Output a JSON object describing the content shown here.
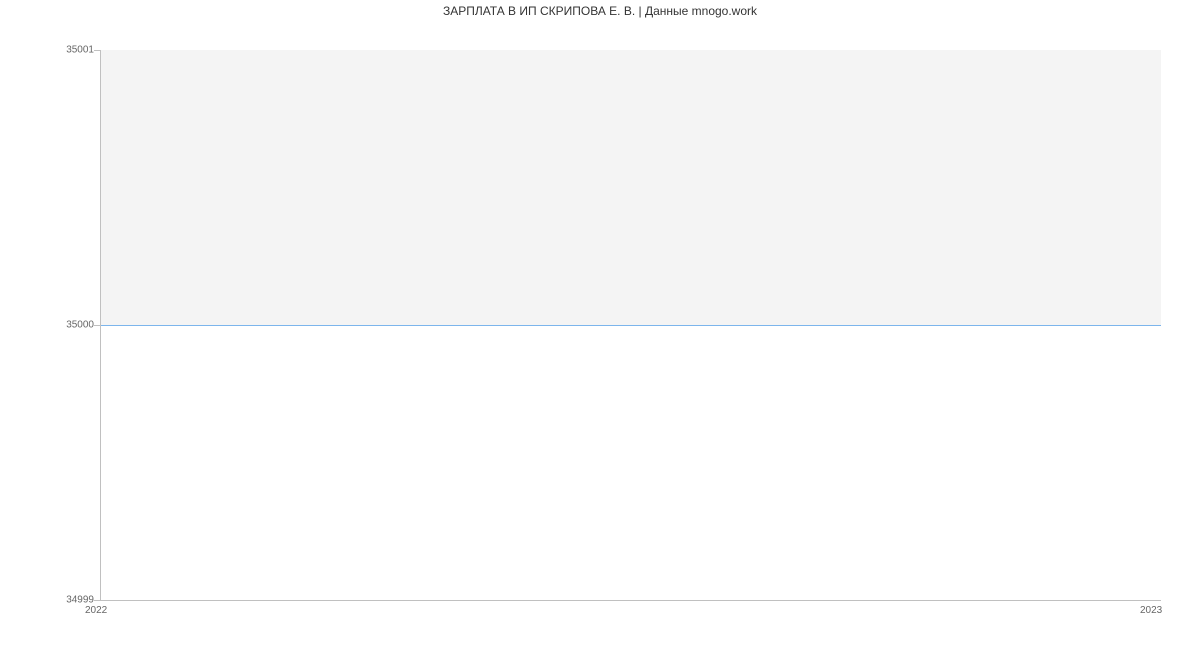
{
  "chart_data": {
    "type": "line",
    "title": "ЗАРПЛАТА В ИП СКРИПОВА Е. В. | Данные mnogo.work",
    "x": [
      2022,
      2023
    ],
    "values": [
      35000,
      35000
    ],
    "y_ticks": {
      "top": "35001",
      "mid": "35000",
      "bottom": "34999"
    },
    "x_ticks": {
      "left": "2022",
      "right": "2023"
    },
    "ylim": [
      34999,
      35001
    ],
    "xlabel": "",
    "ylabel": "",
    "line_color": "#7cb5ec"
  }
}
